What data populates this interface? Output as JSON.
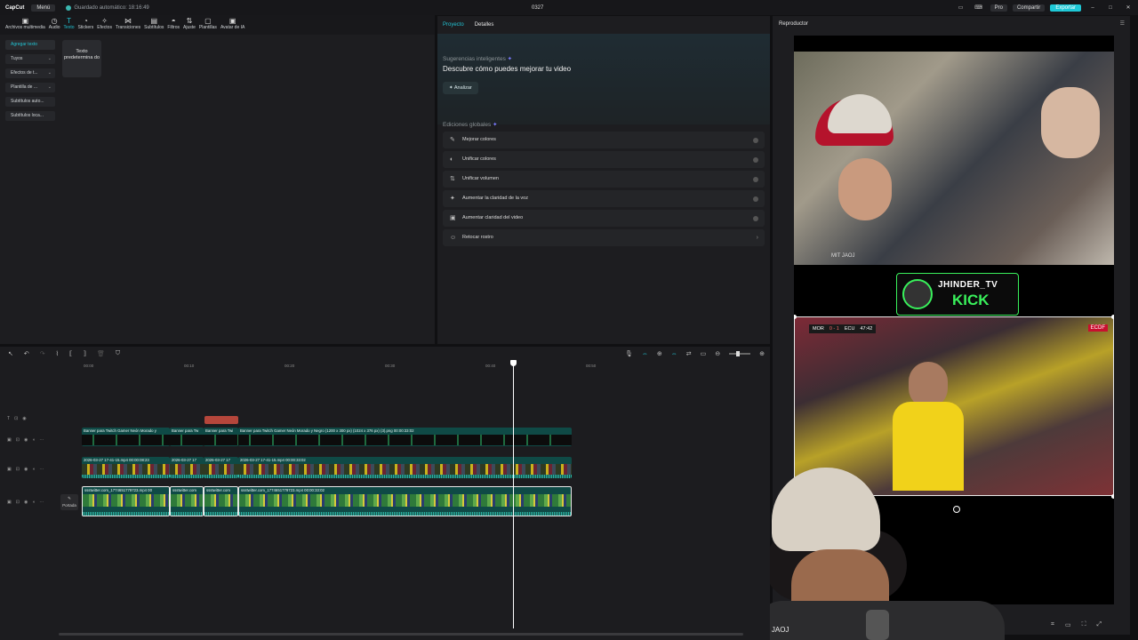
{
  "titlebar": {
    "logo": "CapCut",
    "menu": "Menú",
    "saved": "Guardado automático: 18:16:49",
    "title": "0327",
    "pro": "Pro",
    "share": "Compartir",
    "export": "Exportar"
  },
  "toolbar": {
    "tools": [
      {
        "label": "Archivos multimedia",
        "icon": "▣"
      },
      {
        "label": "Audio",
        "icon": "◷"
      },
      {
        "label": "Texto",
        "icon": "T"
      },
      {
        "label": "Stickers",
        "icon": "◔"
      },
      {
        "label": "Efectos",
        "icon": "✧"
      },
      {
        "label": "Transiciones",
        "icon": "⋈"
      },
      {
        "label": "Subtítulos",
        "icon": "▤"
      },
      {
        "label": "Filtros",
        "icon": "◓"
      },
      {
        "label": "Ajuste",
        "icon": "⇅"
      },
      {
        "label": "Plantillas",
        "icon": "▢"
      },
      {
        "label": "Avatar de IA",
        "icon": "▣"
      }
    ]
  },
  "leftnav": {
    "items": [
      "Agregar texto",
      "Tuyos",
      "Efectos de t...",
      "Plantilla de ...",
      "Subtítulos auto...",
      "Subtítulos loca..."
    ],
    "card": "Texto predetermina do"
  },
  "center": {
    "tabs": [
      "Proyecto",
      "Detalles"
    ],
    "suggest_label": "Sugerencias inteligentes",
    "suggest_desc": "Descubre cómo puedes mejorar tu video",
    "analyze": "Analizar",
    "global_label": "Ediciones globales",
    "global_items": [
      "Mejorar colores",
      "Unificar colores",
      "Unificar volumen",
      "Aumentar la claridad de la voz",
      "Aumentar claridad del video",
      "Retocar rostro"
    ]
  },
  "player": {
    "title": "Reproductor",
    "watermark1": "MIT JAOJ",
    "banner_name": "JHINDER_TV",
    "banner_brand": "KICK",
    "score": {
      "home": "MOR",
      "result": "0 - 1",
      "away": "ECU",
      "time": "47:42"
    },
    "broadcaster": "ECDF",
    "webcam_watermark": "MIT JAOJ"
  },
  "timeline": {
    "ruler": [
      "00:00",
      "00:10",
      "00:20",
      "00:30",
      "00:40",
      "00:50"
    ],
    "cover": "Portada",
    "track1": [
      {
        "name": "Banner para Twitch Gamer Neón Morado y"
      },
      {
        "name": "Banner para Tw"
      },
      {
        "name": "Banner para Twi"
      },
      {
        "name": "Banner para Twitch Gamer Neón Morado y Negro (1200 x 300 px) (1024 x 376 px) (3).png  00:00:33:02"
      }
    ],
    "track2": [
      {
        "name": "2026-03-27 17-41-15.mp4  00:00:08:23"
      },
      {
        "name": "2026-03-27 17"
      },
      {
        "name": "2026-03-27 17"
      },
      {
        "name": "2026-03-27 17-41-15.mp4  00:00:33:02"
      }
    ],
    "track3": [
      {
        "name": "ssstwitter.com_1774651779723.mp4  00"
      },
      {
        "name": "ssstwitter.com"
      },
      {
        "name": "ssstwitter.com"
      },
      {
        "name": "ssstwitter.com_1774651779723.mp4  00:00:33:02"
      }
    ]
  }
}
